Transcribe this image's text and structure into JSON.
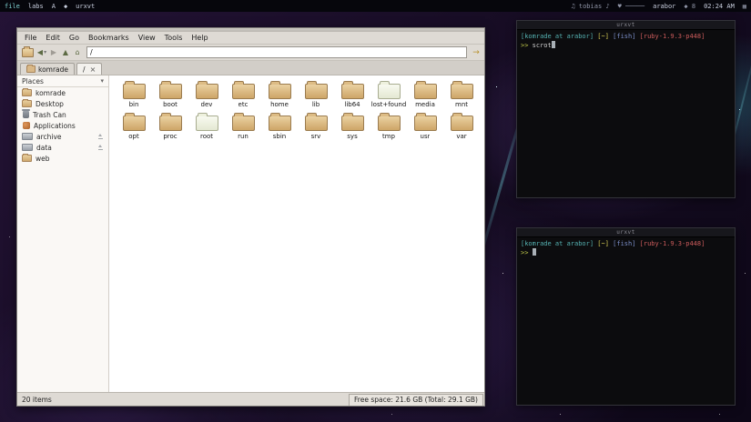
{
  "colors": {
    "term-user": "#55b1b1",
    "term-path": "#d8ce55",
    "term-shell": "#7b8ec8",
    "term-ruby": "#cd5c5c",
    "term-caret": "#c3cb4c",
    "term-fg": "#cfcfcf",
    "accent-free-space": "#e8e4de"
  },
  "topbar": {
    "tags": [
      "file",
      "labs",
      "A",
      "◆",
      "urxvt"
    ],
    "status": [
      "♫ tobias ♪",
      "♥ ─────",
      "arabor",
      "◆ 8",
      "02:24 AM",
      "▦"
    ]
  },
  "fm": {
    "menus": [
      "File",
      "Edit",
      "Go",
      "Bookmarks",
      "View",
      "Tools",
      "Help"
    ],
    "address": "/",
    "tabs": [
      {
        "label": "komrade"
      },
      {
        "label": "/"
      }
    ],
    "places_title": "Places",
    "places": [
      {
        "label": "komrade"
      },
      {
        "label": "Desktop"
      },
      {
        "label": "Trash Can"
      },
      {
        "label": "Applications"
      },
      {
        "label": "archive"
      },
      {
        "label": "data"
      },
      {
        "label": "web"
      }
    ],
    "folders": [
      {
        "label": "bin"
      },
      {
        "label": "boot"
      },
      {
        "label": "dev"
      },
      {
        "label": "etc"
      },
      {
        "label": "home"
      },
      {
        "label": "lib"
      },
      {
        "label": "lib64"
      },
      {
        "label": "lost+found",
        "variant": "light"
      },
      {
        "label": "media"
      },
      {
        "label": "mnt"
      },
      {
        "label": "opt"
      },
      {
        "label": "proc"
      },
      {
        "label": "root",
        "variant": "light"
      },
      {
        "label": "run"
      },
      {
        "label": "sbin"
      },
      {
        "label": "srv"
      },
      {
        "label": "sys"
      },
      {
        "label": "tmp"
      },
      {
        "label": "usr"
      },
      {
        "label": "var"
      }
    ],
    "status_left": "20 items",
    "status_right": "Free space: 21.6 GB (Total: 29.1 GB)"
  },
  "icons": {
    "back": "◀",
    "forward": "▶",
    "up": "▲",
    "home": "⌂",
    "dropdown": "▾",
    "places_caret": "▾",
    "tab_close": "×",
    "jump": "→"
  },
  "term1": {
    "title": "urxvt",
    "prompt_user": "[komrade at arabor]",
    "prompt_path": " [~]",
    "prompt_shell": " [fish]",
    "prompt_ruby": " [ruby-1.9.3-p448]",
    "caret": ">> ",
    "command": "scrot"
  },
  "term2": {
    "title": "urxvt",
    "prompt_user": "[komrade at arabor]",
    "prompt_path": " [~]",
    "prompt_shell": " [fish]",
    "prompt_ruby": " [ruby-1.9.3-p448]",
    "caret": ">> ",
    "command": ""
  }
}
